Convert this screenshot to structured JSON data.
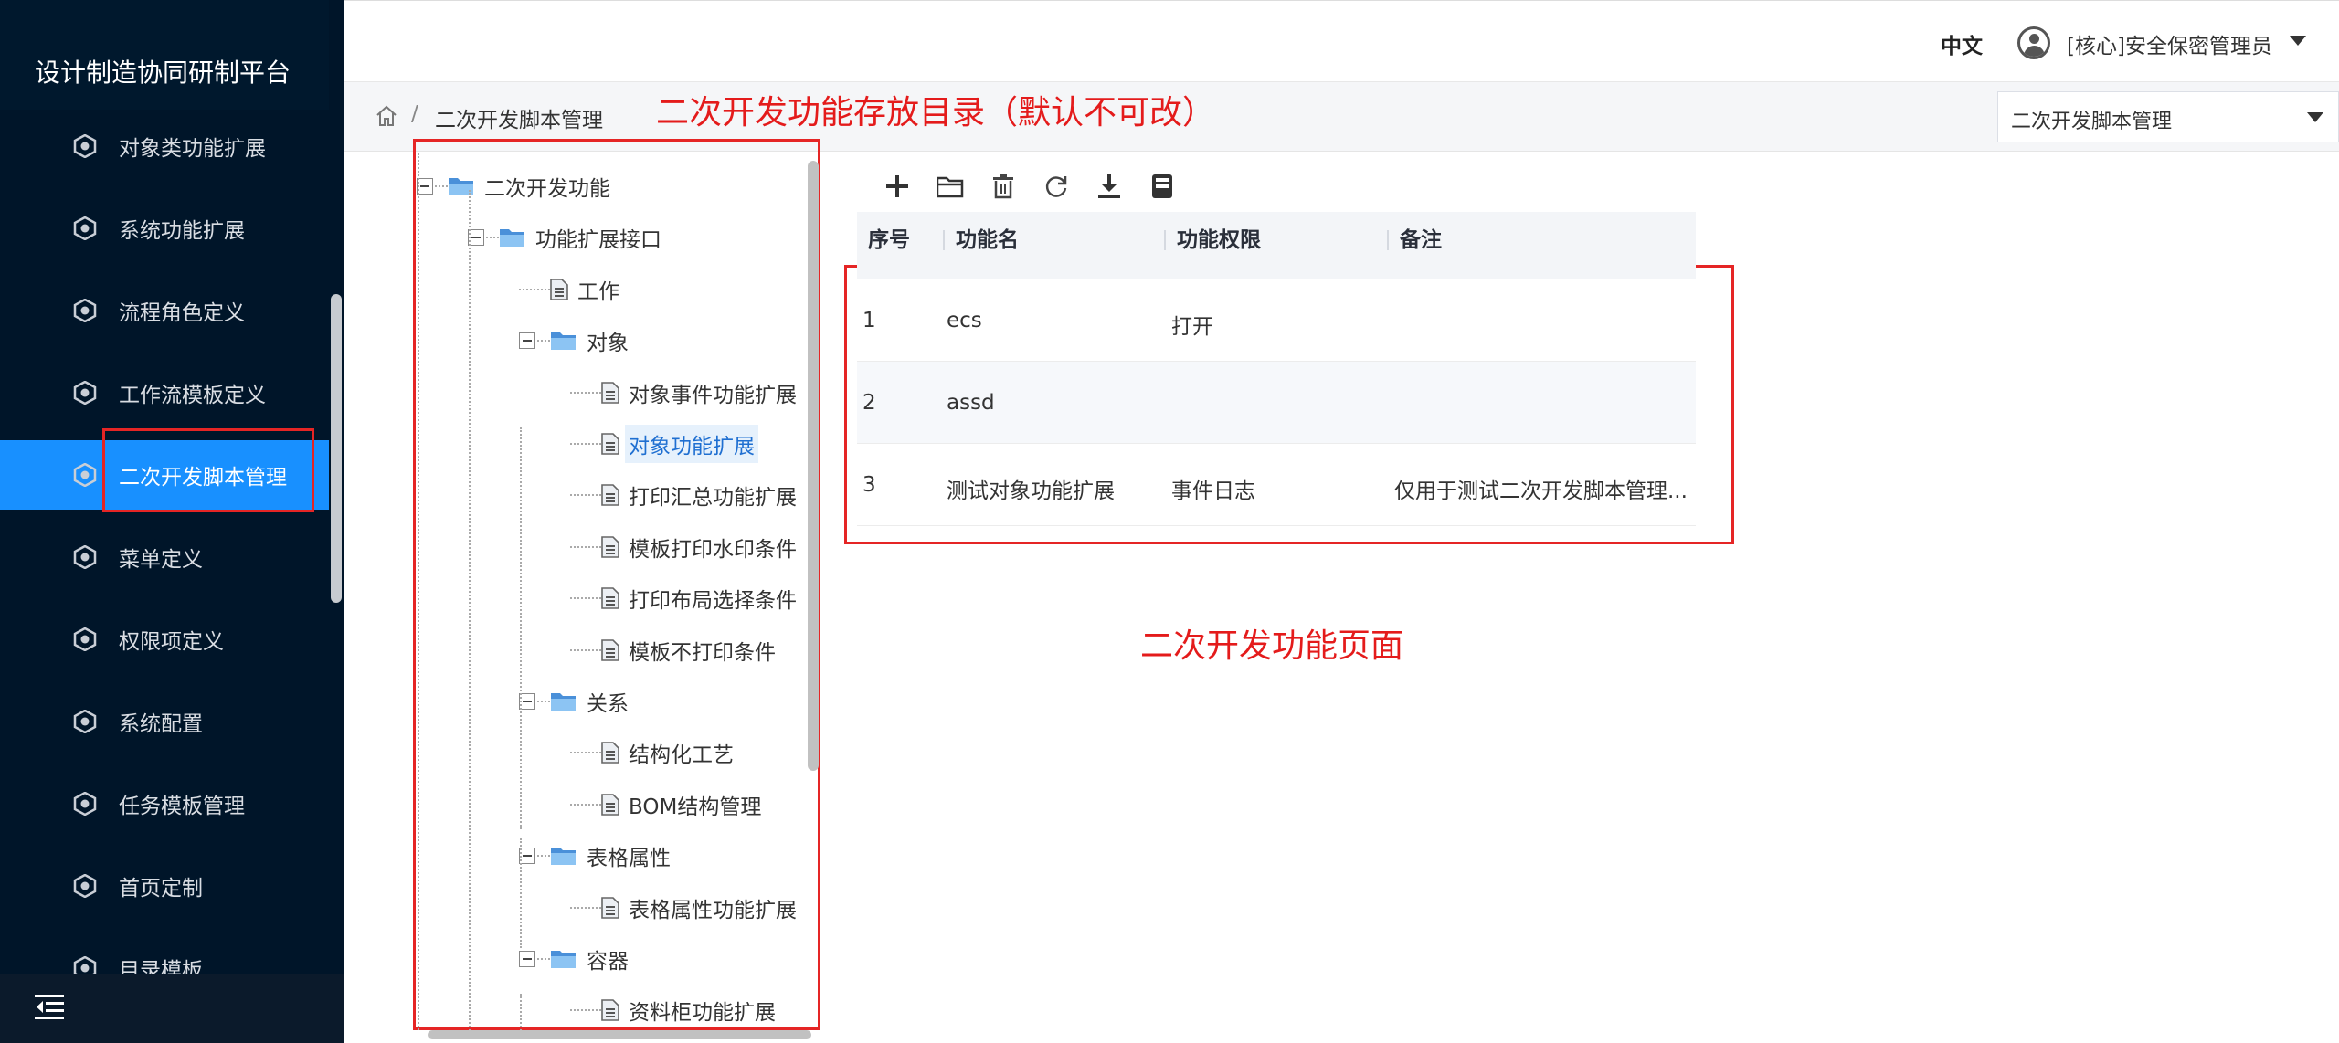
{
  "app": {
    "title": "设计制造协同研制平台"
  },
  "sidebar": {
    "items": [
      {
        "label": "对象类功能扩展",
        "active": false
      },
      {
        "label": "系统功能扩展",
        "active": false
      },
      {
        "label": "流程角色定义",
        "active": false
      },
      {
        "label": "工作流模板定义",
        "active": false
      },
      {
        "label": "二次开发脚本管理",
        "active": true
      },
      {
        "label": "菜单定义",
        "active": false
      },
      {
        "label": "权限项定义",
        "active": false
      },
      {
        "label": "系统配置",
        "active": false
      },
      {
        "label": "任务模板管理",
        "active": false
      },
      {
        "label": "首页定制",
        "active": false
      },
      {
        "label": "目录模板",
        "active": false
      }
    ],
    "collapse_icon": "menu-fold-icon"
  },
  "header": {
    "lang": "中文",
    "user": "[核心]安全保密管理员"
  },
  "breadcrumb": {
    "separator": "/",
    "current": "二次开发脚本管理",
    "select_value": "二次开发脚本管理"
  },
  "annotations": {
    "tree_note": "二次开发功能存放目录（默认不可改）",
    "page_note": "二次开发功能页面"
  },
  "tree": [
    {
      "label": "二次开发功能",
      "type": "folder"
    },
    {
      "label": "功能扩展接口",
      "type": "folder"
    },
    {
      "label": "工作",
      "type": "file"
    },
    {
      "label": "对象",
      "type": "folder"
    },
    {
      "label": "对象事件功能扩展",
      "type": "file"
    },
    {
      "label": "对象功能扩展",
      "type": "file",
      "selected": true
    },
    {
      "label": "打印汇总功能扩展",
      "type": "file"
    },
    {
      "label": "模板打印水印条件",
      "type": "file"
    },
    {
      "label": "打印布局选择条件",
      "type": "file"
    },
    {
      "label": "模板不打印条件",
      "type": "file"
    },
    {
      "label": "关系",
      "type": "folder"
    },
    {
      "label": "结构化工艺",
      "type": "file"
    },
    {
      "label": "BOM结构管理",
      "type": "file"
    },
    {
      "label": "表格属性",
      "type": "folder"
    },
    {
      "label": "表格属性功能扩展",
      "type": "file"
    },
    {
      "label": "容器",
      "type": "folder"
    },
    {
      "label": "资料柜功能扩展",
      "type": "file"
    }
  ],
  "toolbar": [
    "add-icon",
    "folder-icon",
    "delete-icon",
    "refresh-icon",
    "download-icon",
    "save-icon"
  ],
  "table": {
    "headers": [
      "序号",
      "功能名",
      "功能权限",
      "备注"
    ],
    "rows": [
      [
        "1",
        "ecs",
        "打开",
        ""
      ],
      [
        "2",
        "assd",
        "",
        ""
      ],
      [
        "3",
        "测试对象功能扩展",
        "事件日志",
        "仅用于测试二次开发脚本管理..."
      ]
    ]
  },
  "colors": {
    "sidebar_bg": "#001529",
    "active": "#1890ff",
    "annotation": "#e41b1b"
  }
}
